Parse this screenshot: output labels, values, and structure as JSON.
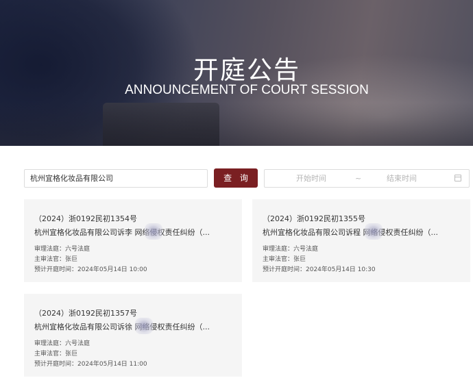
{
  "hero": {
    "title": "开庭公告",
    "subtitle": "ANNOUNCEMENT OF COURT SESSION"
  },
  "search": {
    "value": "杭州宜格化妆品有限公司",
    "button_label": "查 询",
    "start_placeholder": "开始时间",
    "separator": "~",
    "end_placeholder": "结束时间",
    "calendar_icon": "calendar-icon"
  },
  "cards": [
    {
      "case_no": "（2024）浙0192民初1354号",
      "title": "杭州宜格化妆品有限公司诉李 网络侵权责任纠纷（...",
      "court_room": "审理法庭：六号法庭",
      "judge": "主审法官：张巨",
      "time": "预计开庭时间：2024年05月14日 10:00"
    },
    {
      "case_no": "（2024）浙0192民初1355号",
      "title": "杭州宜格化妆品有限公司诉程 网络侵权责任纠纷（...",
      "court_room": "审理法庭：六号法庭",
      "judge": "主审法官：张巨",
      "time": "预计开庭时间：2024年05月14日 10:30"
    },
    {
      "case_no": "（2024）浙0192民初1357号",
      "title": "杭州宜格化妆品有限公司诉徐 网络侵权责任纠纷（...",
      "court_room": "审理法庭：六号法庭",
      "judge": "主审法官：张巨",
      "time": "预计开庭时间：2024年05月14日 11:00"
    }
  ],
  "colors": {
    "accent": "#7a1f22",
    "card_bg": "#f5f5f5"
  }
}
